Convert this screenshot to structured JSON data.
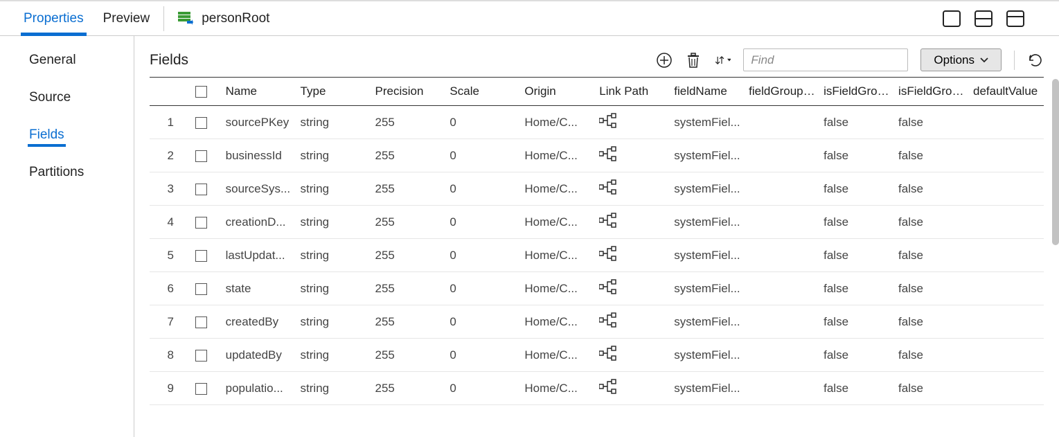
{
  "topbar": {
    "tabs": [
      {
        "label": "Properties",
        "active": true
      },
      {
        "label": "Preview",
        "active": false
      }
    ],
    "title": "personRoot"
  },
  "sidebar": {
    "items": [
      {
        "label": "General",
        "active": false
      },
      {
        "label": "Source",
        "active": false
      },
      {
        "label": "Fields",
        "active": true
      },
      {
        "label": "Partitions",
        "active": false
      }
    ]
  },
  "content": {
    "title": "Fields",
    "find_placeholder": "Find",
    "options_label": "Options"
  },
  "table": {
    "columns": [
      "",
      "",
      "Name",
      "Type",
      "Precision",
      "Scale",
      "Origin",
      "Link Path",
      "fieldName",
      "fieldGroupName",
      "isFieldGroup",
      "isFieldGroupKey",
      "defaultValue"
    ],
    "rows": [
      {
        "num": "1",
        "name": "sourcePKey",
        "type": "string",
        "precision": "255",
        "scale": "0",
        "origin": "Home/C...",
        "fieldName": "systemFiel...",
        "fieldGroupName": "",
        "isFieldGroup": "false",
        "isFieldGroupKey": "false",
        "defaultValue": ""
      },
      {
        "num": "2",
        "name": "businessId",
        "type": "string",
        "precision": "255",
        "scale": "0",
        "origin": "Home/C...",
        "fieldName": "systemFiel...",
        "fieldGroupName": "",
        "isFieldGroup": "false",
        "isFieldGroupKey": "false",
        "defaultValue": ""
      },
      {
        "num": "3",
        "name": "sourceSys...",
        "type": "string",
        "precision": "255",
        "scale": "0",
        "origin": "Home/C...",
        "fieldName": "systemFiel...",
        "fieldGroupName": "",
        "isFieldGroup": "false",
        "isFieldGroupKey": "false",
        "defaultValue": ""
      },
      {
        "num": "4",
        "name": "creationD...",
        "type": "string",
        "precision": "255",
        "scale": "0",
        "origin": "Home/C...",
        "fieldName": "systemFiel...",
        "fieldGroupName": "",
        "isFieldGroup": "false",
        "isFieldGroupKey": "false",
        "defaultValue": ""
      },
      {
        "num": "5",
        "name": "lastUpdat...",
        "type": "string",
        "precision": "255",
        "scale": "0",
        "origin": "Home/C...",
        "fieldName": "systemFiel...",
        "fieldGroupName": "",
        "isFieldGroup": "false",
        "isFieldGroupKey": "false",
        "defaultValue": ""
      },
      {
        "num": "6",
        "name": "state",
        "type": "string",
        "precision": "255",
        "scale": "0",
        "origin": "Home/C...",
        "fieldName": "systemFiel...",
        "fieldGroupName": "",
        "isFieldGroup": "false",
        "isFieldGroupKey": "false",
        "defaultValue": ""
      },
      {
        "num": "7",
        "name": "createdBy",
        "type": "string",
        "precision": "255",
        "scale": "0",
        "origin": "Home/C...",
        "fieldName": "systemFiel...",
        "fieldGroupName": "",
        "isFieldGroup": "false",
        "isFieldGroupKey": "false",
        "defaultValue": ""
      },
      {
        "num": "8",
        "name": "updatedBy",
        "type": "string",
        "precision": "255",
        "scale": "0",
        "origin": "Home/C...",
        "fieldName": "systemFiel...",
        "fieldGroupName": "",
        "isFieldGroup": "false",
        "isFieldGroupKey": "false",
        "defaultValue": ""
      },
      {
        "num": "9",
        "name": "populatio...",
        "type": "string",
        "precision": "255",
        "scale": "0",
        "origin": "Home/C...",
        "fieldName": "systemFiel...",
        "fieldGroupName": "",
        "isFieldGroup": "false",
        "isFieldGroupKey": "false",
        "defaultValue": ""
      }
    ]
  }
}
